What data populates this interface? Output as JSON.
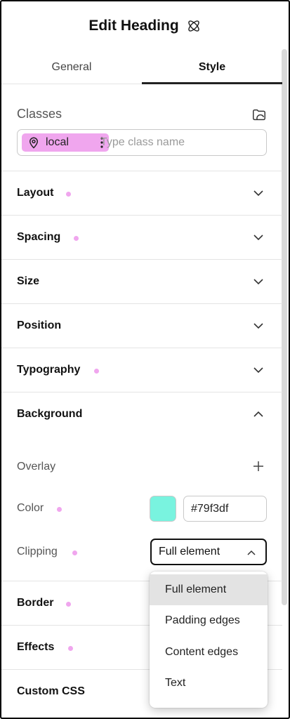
{
  "header": {
    "title": "Edit Heading",
    "icon": "atom-icon"
  },
  "tabs": [
    {
      "label": "General",
      "active": false
    },
    {
      "label": "Style",
      "active": true
    }
  ],
  "classes": {
    "label": "Classes",
    "chip_label": "local",
    "placeholder": "Type class name"
  },
  "sections": {
    "layout": {
      "label": "Layout",
      "modified": true
    },
    "spacing": {
      "label": "Spacing",
      "modified": true
    },
    "size": {
      "label": "Size",
      "modified": false
    },
    "position": {
      "label": "Position",
      "modified": false
    },
    "typography": {
      "label": "Typography",
      "modified": true
    },
    "background": {
      "label": "Background",
      "expanded": true
    },
    "border": {
      "label": "Border",
      "modified": true
    },
    "effects": {
      "label": "Effects",
      "modified": true
    },
    "custom_css": {
      "label": "Custom CSS",
      "modified": false
    }
  },
  "background": {
    "overlay_label": "Overlay",
    "color_label": "Color",
    "color_value": "#79f3df",
    "clipping_label": "Clipping",
    "clipping_value": "Full element"
  },
  "clipping_options": [
    "Full element",
    "Padding edges",
    "Content edges",
    "Text"
  ],
  "colors": {
    "accent_dot": "#f0a6ee",
    "chip_bg": "#f0a6ee",
    "swatch": "#79f3df"
  }
}
